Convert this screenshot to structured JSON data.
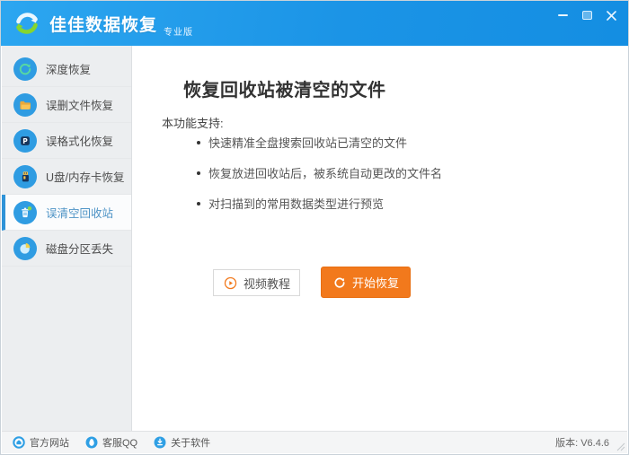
{
  "window": {
    "title": "佳佳数据恢复",
    "edition": "专业版"
  },
  "sidebar": {
    "items": [
      {
        "label": "深度恢复",
        "icon": "deep-scan-refresh-icon",
        "selected": false
      },
      {
        "label": "误删文件恢复",
        "icon": "deleted-file-folder-icon",
        "selected": false
      },
      {
        "label": "误格式化恢复",
        "icon": "format-recovery-icon",
        "selected": false
      },
      {
        "label": "U盘/内存卡恢复",
        "icon": "usb-card-icon",
        "selected": false
      },
      {
        "label": "误清空回收站",
        "icon": "recycle-bin-trash-icon",
        "selected": true
      },
      {
        "label": "磁盘分区丢失",
        "icon": "disk-partition-pie-icon",
        "selected": false
      }
    ]
  },
  "main": {
    "title": "恢复回收站被清空的文件",
    "support_label": "本功能支持:",
    "features": [
      "快速精准全盘搜索回收站已清空的文件",
      "恢复放进回收站后，被系统自动更改的文件名",
      "对扫描到的常用数据类型进行预览"
    ],
    "video_button_label": "视频教程",
    "start_button_label": "开始恢复"
  },
  "statusbar": {
    "links": [
      {
        "label": "官方网站",
        "icon": "home-icon"
      },
      {
        "label": "客服QQ",
        "icon": "qq-icon"
      },
      {
        "label": "关于软件",
        "icon": "about-download-icon"
      }
    ],
    "version": "版本: V6.4.6"
  },
  "colors": {
    "brand_blue": "#1b94e6",
    "accent_orange": "#f2791c",
    "icon_blue": "#2f9ce2",
    "selected_text_blue": "#4f94c6"
  }
}
